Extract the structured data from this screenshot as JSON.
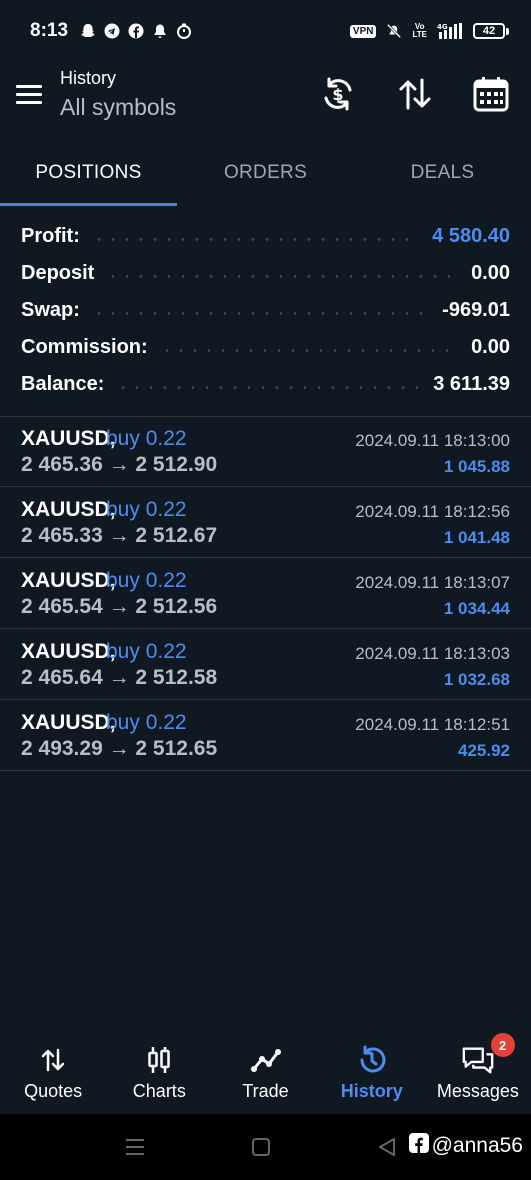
{
  "status_bar": {
    "time": "8:13",
    "vpn": "VPN",
    "network": "Vo\nLTE",
    "signal": "4G",
    "battery": "42"
  },
  "header": {
    "title": "History",
    "subtitle": "All symbols"
  },
  "tabs": [
    {
      "label": "POSITIONS",
      "active": true
    },
    {
      "label": "ORDERS",
      "active": false
    },
    {
      "label": "DEALS",
      "active": false
    }
  ],
  "summary": [
    {
      "label": "Profit:",
      "value": "4 580.40"
    },
    {
      "label": "Deposit",
      "value": "0.00"
    },
    {
      "label": "Swap:",
      "value": "-969.01"
    },
    {
      "label": "Commission:",
      "value": "0.00"
    },
    {
      "label": "Balance:",
      "value": "3 611.39"
    }
  ],
  "deals": [
    {
      "symbol": "XAUUSD,",
      "side": "buy 0.22",
      "prices": "2 465.36 → 2 512.90",
      "time": "2024.09.11 18:13:00",
      "profit": "1 045.88"
    },
    {
      "symbol": "XAUUSD,",
      "side": "buy 0.22",
      "prices": "2 465.33 → 2 512.67",
      "time": "2024.09.11 18:12:56",
      "profit": "1 041.48"
    },
    {
      "symbol": "XAUUSD,",
      "side": "buy 0.22",
      "prices": "2 465.54 → 2 512.56",
      "time": "2024.09.11 18:13:07",
      "profit": "1 034.44"
    },
    {
      "symbol": "XAUUSD,",
      "side": "buy 0.22",
      "prices": "2 465.64 → 2 512.58",
      "time": "2024.09.11 18:13:03",
      "profit": "1 032.68"
    },
    {
      "symbol": "XAUUSD,",
      "side": "buy 0.22",
      "prices": "2 493.29 → 2 512.65",
      "time": "2024.09.11 18:12:51",
      "profit": "425.92"
    }
  ],
  "bottom_nav": [
    {
      "label": "Quotes",
      "icon": "quotes-icon",
      "active": false
    },
    {
      "label": "Charts",
      "icon": "candlestick-icon",
      "active": false
    },
    {
      "label": "Trade",
      "icon": "trade-line-icon",
      "active": false
    },
    {
      "label": "History",
      "icon": "history-icon",
      "active": true
    },
    {
      "label": "Messages",
      "icon": "messages-icon",
      "active": false,
      "badge": "2"
    }
  ],
  "watermark": "@anna56",
  "colors": {
    "background": "#101821",
    "accent": "#4c8df0",
    "tab_indicator": "#3f86e8",
    "badge": "#e2413a"
  }
}
